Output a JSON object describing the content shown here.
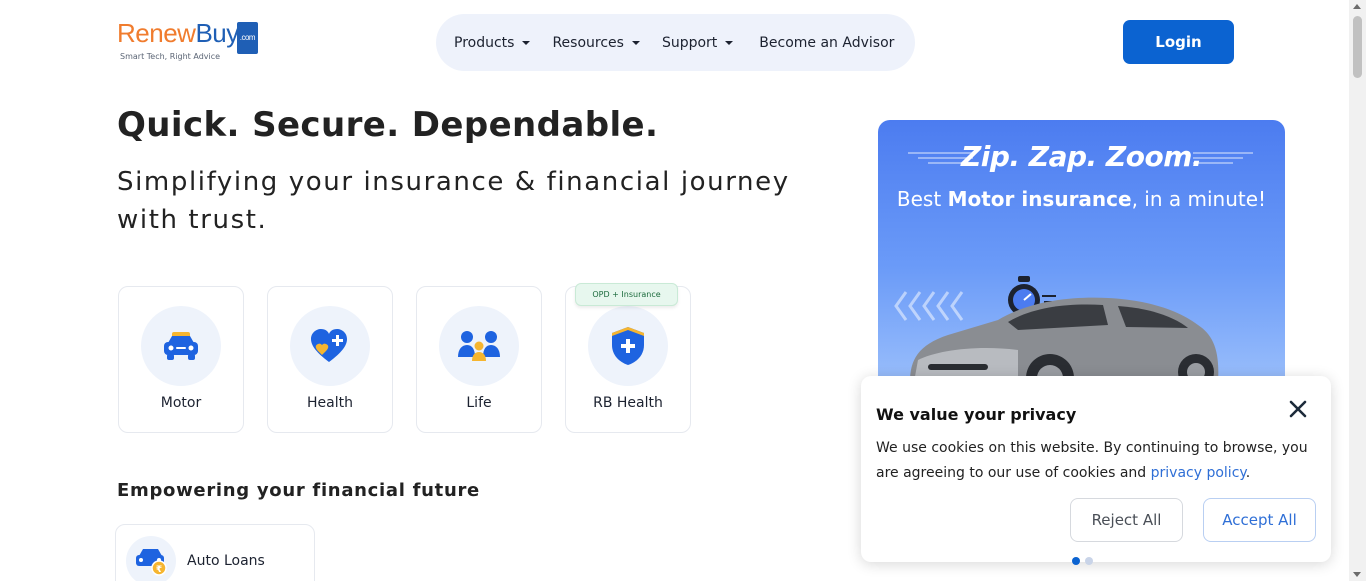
{
  "brand": {
    "name_part1": "Renew",
    "name_part2": "Buy",
    "domain_suffix": ".com",
    "tagline": "Smart Tech, Right Advice",
    "colors": {
      "orange": "#f07c2e",
      "blue": "#1f5fb5"
    }
  },
  "nav": {
    "items": [
      {
        "label": "Products",
        "has_dropdown": true
      },
      {
        "label": "Resources",
        "has_dropdown": true
      },
      {
        "label": "Support",
        "has_dropdown": true
      },
      {
        "label": "Become an Advisor",
        "has_dropdown": false
      }
    ],
    "login_label": "Login"
  },
  "hero": {
    "title": "Quick. Secure. Dependable.",
    "subtitle": "Simplifying your insurance & financial journey with trust."
  },
  "products": [
    {
      "label": "Motor",
      "icon": "car-icon"
    },
    {
      "label": "Health",
      "icon": "heart-plus-icon"
    },
    {
      "label": "Life",
      "icon": "family-icon"
    },
    {
      "label": "RB Health",
      "icon": "shield-plus-icon",
      "badge": "OPD + Insurance"
    }
  ],
  "section": {
    "title": "Empowering your financial future",
    "loans": [
      {
        "label": "Auto Loans",
        "icon": "car-rupee-icon"
      }
    ]
  },
  "banner": {
    "headline": "Zip. Zap. Zoom.",
    "sub_prefix": "Best ",
    "sub_bold": "Motor insurance",
    "sub_suffix": ", in a minute!",
    "carousel": {
      "slides": 2,
      "active": 1
    }
  },
  "cookie": {
    "title": "We value your privacy",
    "text": "We use cookies on this website. By continuing to browse, you are agreeing to our use of cookies and ",
    "link": "privacy policy",
    "text_end": ".",
    "reject_label": "Reject All",
    "accept_label": "Accept All"
  },
  "colors": {
    "primary": "#0b63d1",
    "nav_bg": "#eef2fb",
    "icon_blue": "#1e63e0",
    "icon_gold": "#f6b52f"
  }
}
